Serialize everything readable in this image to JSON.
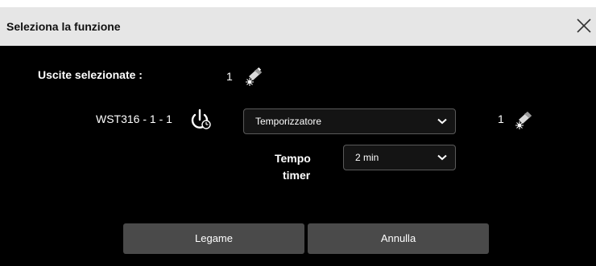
{
  "dialog": {
    "title": "Seleziona la funzione"
  },
  "selected": {
    "label": "Uscite selezionate :",
    "count": "1",
    "icon": "light-output-icon"
  },
  "row": {
    "device": "WST316 - 1 - 1",
    "device_icon": "power-timer-icon",
    "function_value": "Temporizzatore",
    "count": "1",
    "count_icon": "light-output-icon"
  },
  "timer": {
    "label_line1": "Tempo",
    "label_line2": "timer",
    "value": "2 min"
  },
  "buttons": {
    "link": "Legame",
    "cancel": "Annulla"
  },
  "colors": {
    "background": "#000000",
    "titlebar": "#e6e6e6",
    "button": "#4a4a4a",
    "select_border": "#5a5a5a"
  }
}
